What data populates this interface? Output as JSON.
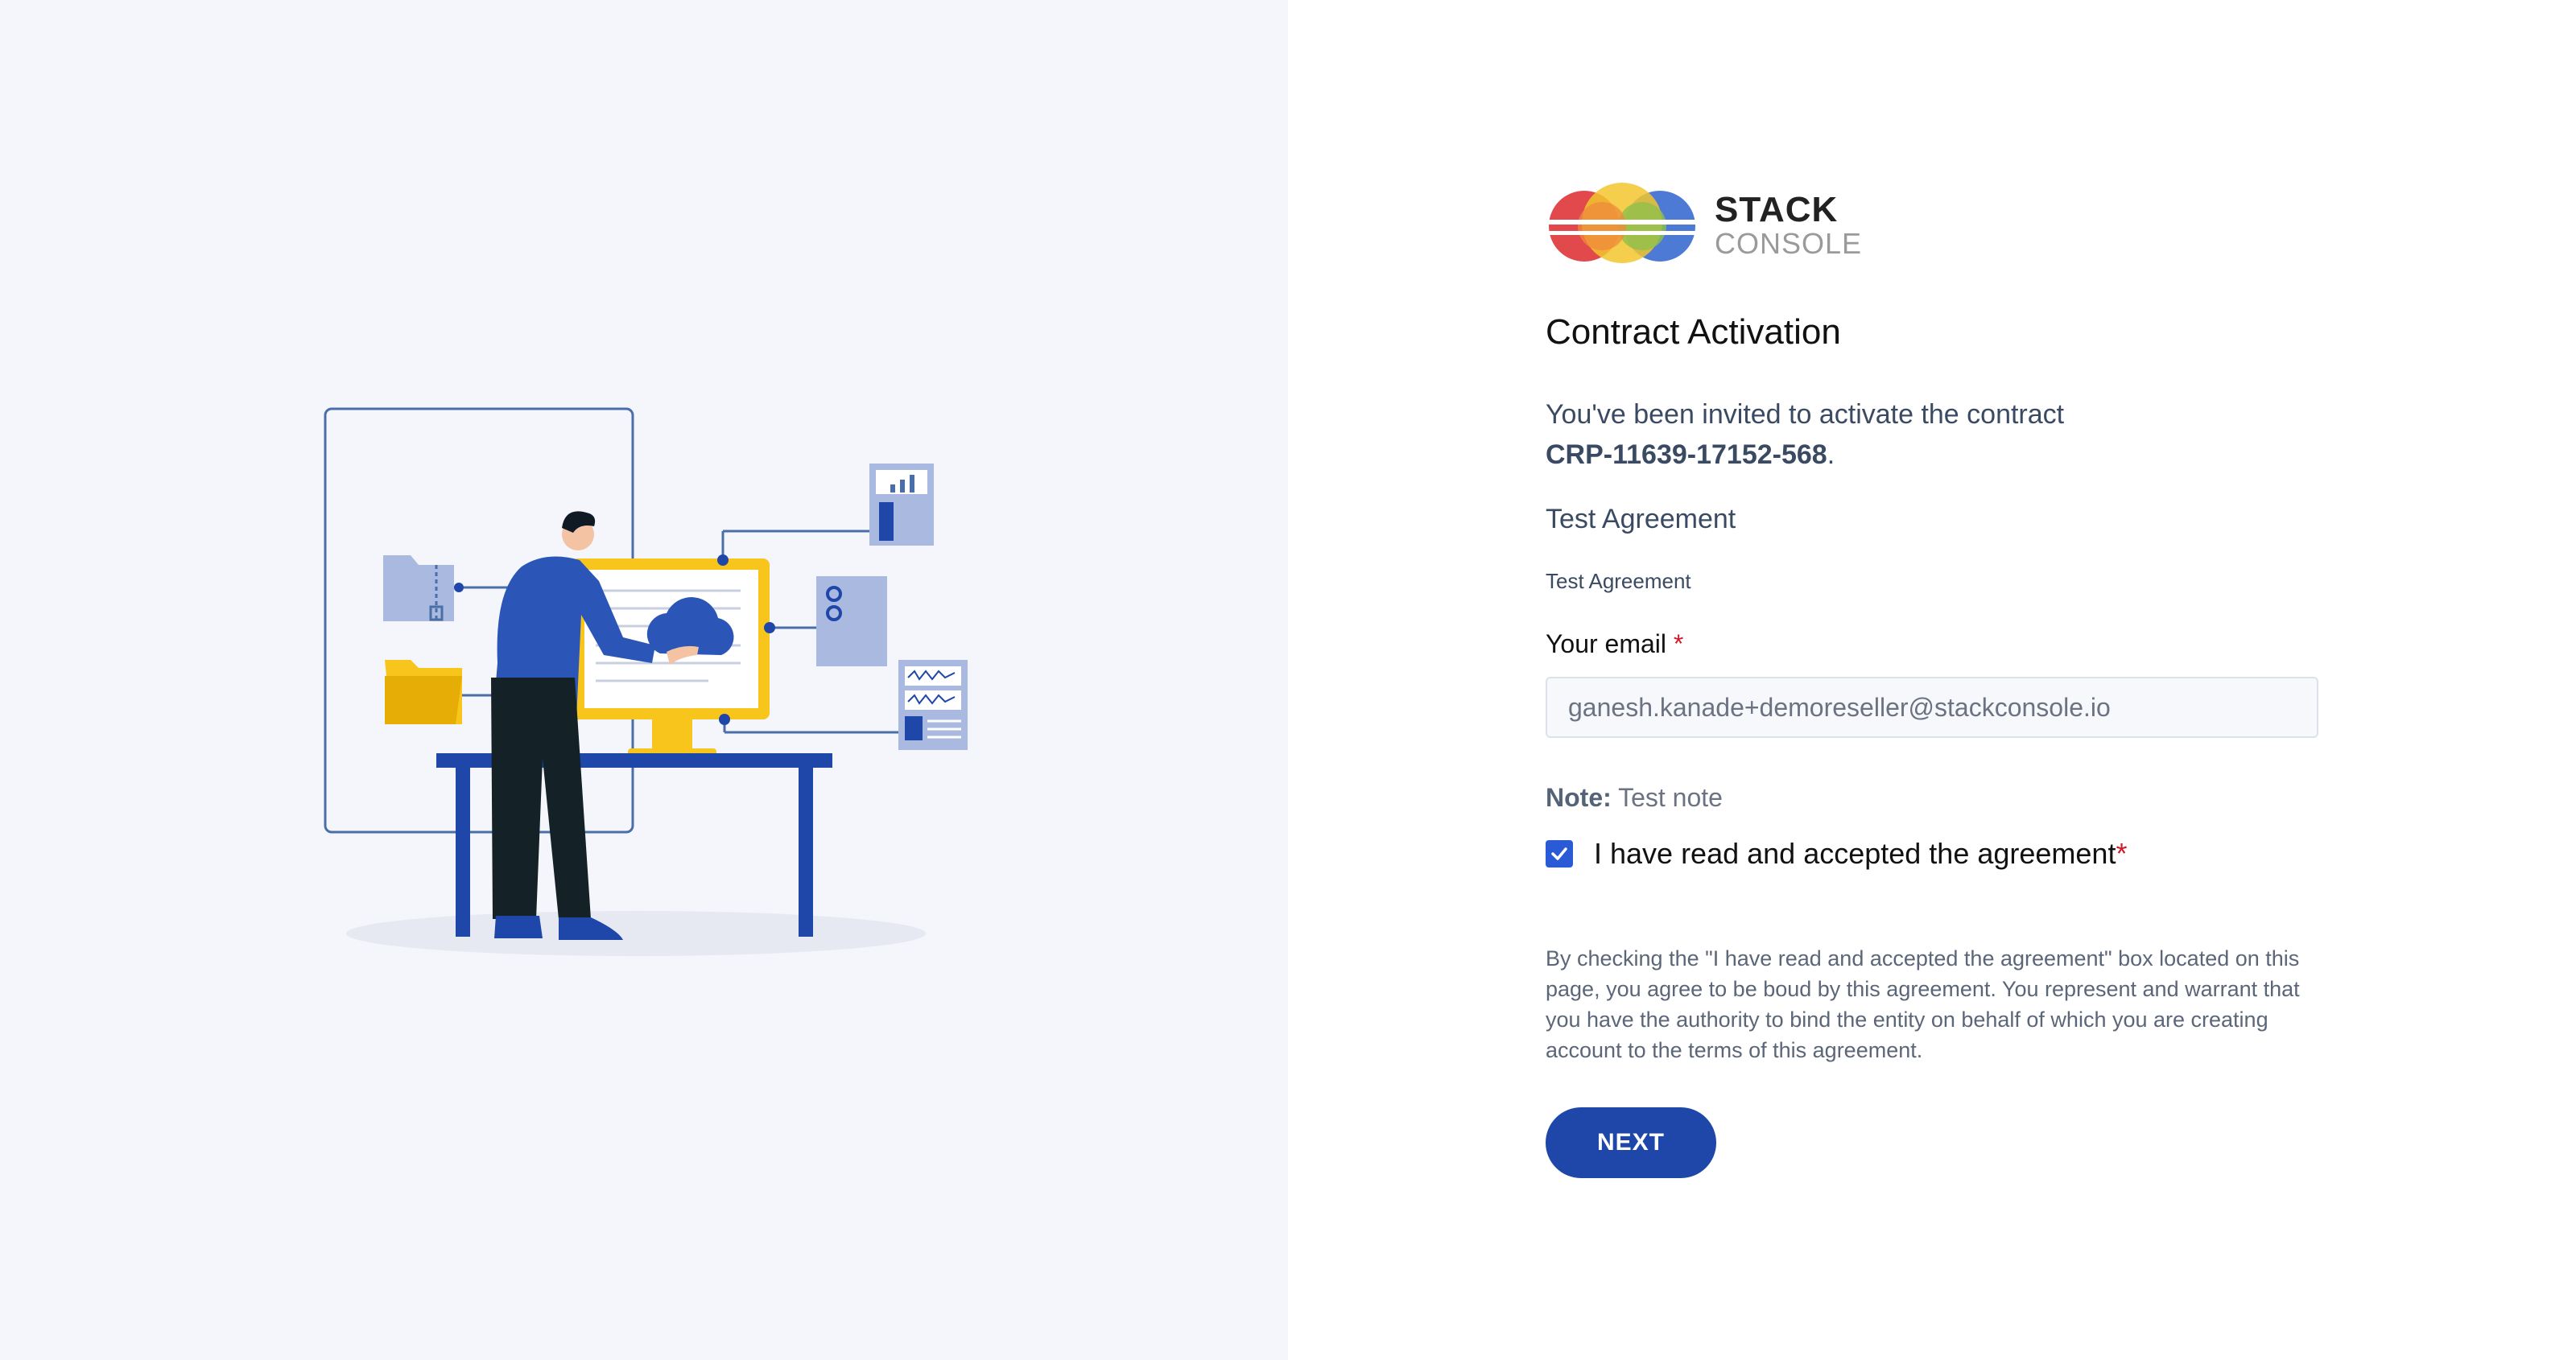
{
  "brand": {
    "logo_line1": "STACK",
    "logo_line2": "CONSOLE",
    "colors": {
      "red": "#e03a3e",
      "yellow": "#f2c62d",
      "green": "#8fc04a",
      "blue": "#3d6fd1"
    }
  },
  "page": {
    "title": "Contract Activation"
  },
  "invite": {
    "text": "You've been invited to activate the contract",
    "contract_id": "CRP-11639-17152-568",
    "suffix": "."
  },
  "agreement": {
    "title": "Test Agreement",
    "body": "Test Agreement"
  },
  "email": {
    "label": "Your email",
    "required_mark": "*",
    "value": "ganesh.kanade+demoreseller@stackconsole.io"
  },
  "note": {
    "label": "Note:",
    "text": "Test note"
  },
  "accept": {
    "checked": true,
    "label": "I have read and accepted the agreement",
    "required_mark": "*"
  },
  "disclaimer": "By checking the \"I have read and accepted the agreement\" box located on this page, you agree to be boud by this agreement. You represent and warrant that you have the authority to bind the entity on behalf of which you are creating account to the terms of this agreement.",
  "actions": {
    "next_label": "NEXT"
  },
  "theme": {
    "left_bg": "#f4f6fb",
    "primary": "#1f47a9",
    "accent_yellow": "#f7c51c"
  }
}
